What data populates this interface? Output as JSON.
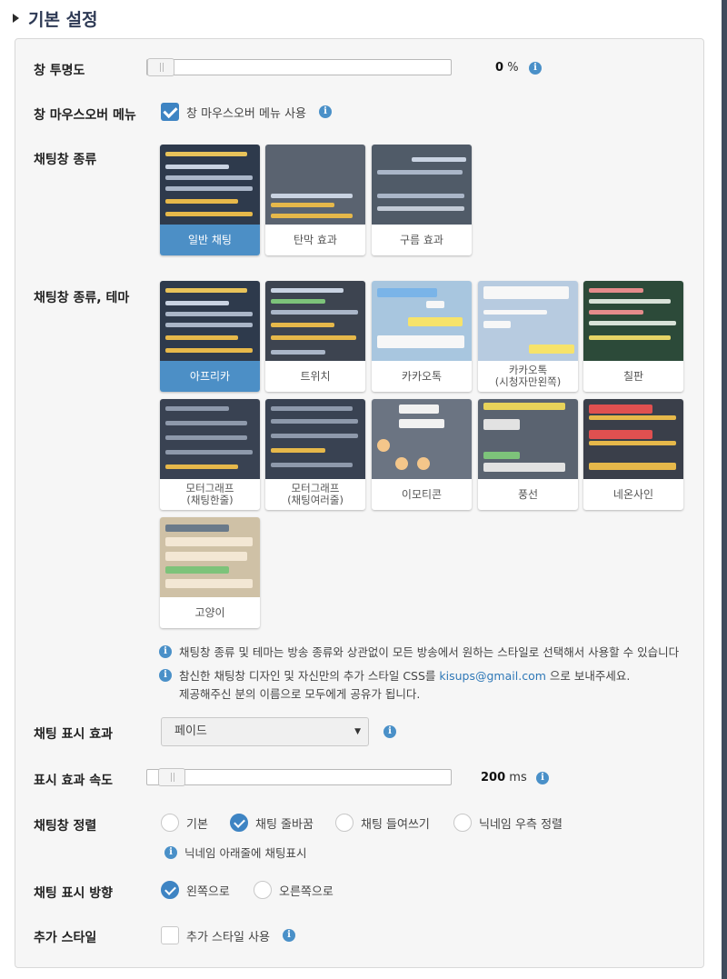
{
  "section_title": "기본 설정",
  "opacity": {
    "label": "창 투명도",
    "value": "0",
    "unit": "%",
    "slider_fraction": 0.0
  },
  "mouseover": {
    "label": "창 마우스오버 메뉴",
    "checkbox_label": "창 마우스오버 메뉴 사용",
    "checked": true
  },
  "chat_type": {
    "label": "채팅창 종류",
    "options": [
      "일반 채팅",
      "탄막 효과",
      "구름 효과"
    ],
    "selected": "일반 채팅"
  },
  "theme": {
    "label": "채팅창 종류, 테마",
    "options": [
      "아프리카",
      "트위치",
      "카카오톡",
      "카카오톡\n(시청자만왼쪽)",
      "칠판",
      "모터그래프\n(채팅한줄)",
      "모터그래프\n(채팅여러줄)",
      "이모티콘",
      "풍선",
      "네온사인",
      "고양이"
    ],
    "selected": "아프리카",
    "note1": "채팅창 종류 및 테마는 방송 종류와 상관없이 모든 방송에서 원하는 스타일로 선택해서 사용할 수 있습니다",
    "note2_pre": "참신한 채팅창 디자인 및 자신만의 추가 스타일 CSS를",
    "note2_email": "kisups@gmail.com",
    "note2_post": "으로 보내주세요.",
    "note3": "제공해주신 분의 이름으로 모두에게 공유가 됩니다."
  },
  "effect": {
    "label": "채팅 표시 효과",
    "value": "페이드"
  },
  "speed": {
    "label": "표시 효과 속도",
    "value": "200",
    "unit": "ms",
    "slider_fraction": 0.0
  },
  "align": {
    "label": "채팅창 정렬",
    "options": [
      "기본",
      "채팅 줄바꿈",
      "채팅 들여쓰기",
      "닉네임 우측 정렬"
    ],
    "selected": "채팅 줄바꿈",
    "note": "닉네임 아래줄에 채팅표시"
  },
  "direction": {
    "label": "채팅 표시 방향",
    "options": [
      "왼쪽으로",
      "오른쪽으로"
    ],
    "selected": "왼쪽으로"
  },
  "extra": {
    "label": "추가 스타일",
    "checkbox_label": "추가 스타일 사용",
    "checked": false
  },
  "colors": {
    "accent": "#3e84c3",
    "title": "#2e3a55",
    "link": "#2f78b7"
  },
  "icons": [
    "triangle-right-icon",
    "info-icon",
    "check-icon"
  ]
}
